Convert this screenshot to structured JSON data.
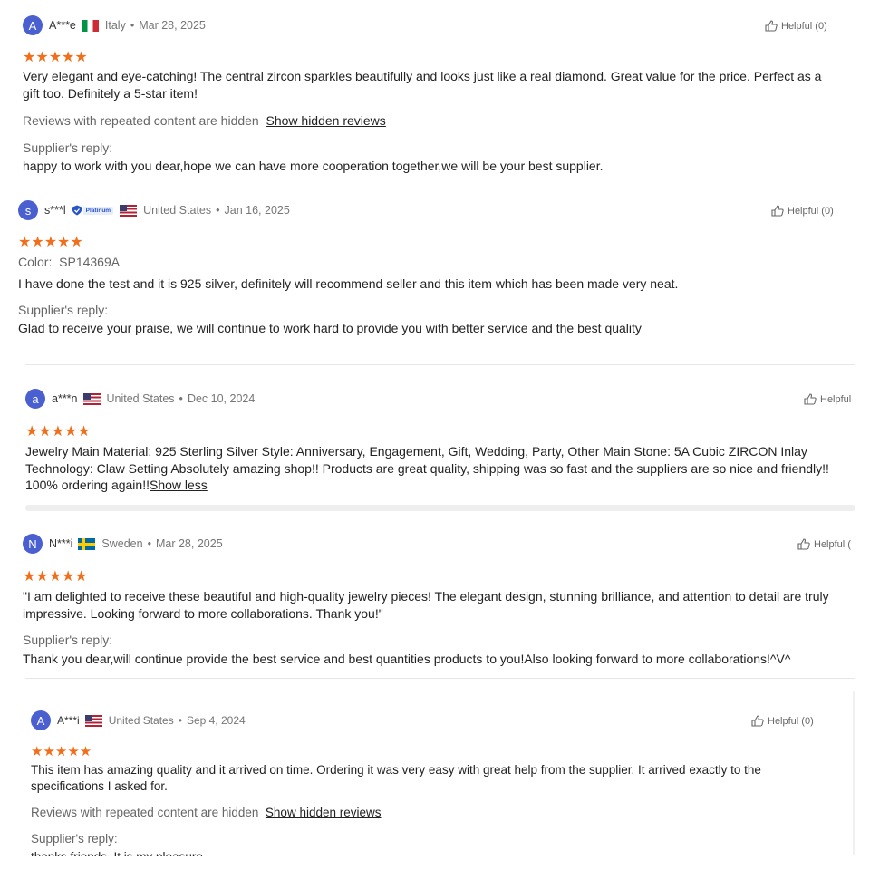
{
  "reviews": [
    {
      "initial": "A",
      "name": "A***e",
      "country": "Italy",
      "date": "Mar 28, 2025",
      "helpful": "Helpful (0)",
      "text": "Very elegant and eye-catching! The central zircon sparkles beautifully and looks just like a real diamond. Great value for the price. Perfect as a gift too. Definitely a 5-star item!",
      "hidden_note": "Reviews with repeated content are hidden",
      "hidden_link": "Show hidden reviews",
      "reply_label": "Supplier's reply:",
      "reply": "happy to work with you dear,hope we can have more cooperation together,we will be your best supplier."
    },
    {
      "initial": "s",
      "name": "s***l",
      "badge": "Platinum",
      "country": "United States",
      "date": "Jan 16, 2025",
      "helpful": "Helpful (0)",
      "color_label": "Color:",
      "color_value": "SP14369A",
      "text": "I have done the test and it is 925 silver, definitely will recommend seller and this item which has been made very neat.",
      "reply_label": "Supplier's reply:",
      "reply": "Glad to receive your praise, we will continue to work hard to provide you with better service and the best quality"
    },
    {
      "initial": "a",
      "name": "a***n",
      "country": "United States",
      "date": "Dec 10, 2024",
      "helpful": "Helpful",
      "text": "Jewelry Main Material: 925 Sterling Silver   Style: Anniversary, Engagement, Gift, Wedding, Party, Other Main Stone: 5A Cubic ZIRCON Inlay Technology: Claw Setting Absolutely amazing shop!! Products are great quality, shipping was so fast and the suppliers are so nice and friendly!! 100% ordering again!!",
      "show_less": "Show less"
    },
    {
      "initial": "N",
      "name": "N***i",
      "country": "Sweden",
      "date": "Mar 28, 2025",
      "helpful": "Helpful (",
      "text": "\"I am delighted to receive these beautiful and high-quality jewelry pieces! The elegant design, stunning brilliance, and attention to detail are truly impressive. Looking forward to more collaborations. Thank you!\"",
      "reply_label": "Supplier's reply:",
      "reply": "Thank you dear,will continue provide the best service and best quantities products to you!Also looking forward to more collaborations!^V^"
    },
    {
      "initial": "A",
      "name": "A***i",
      "country": "United States",
      "date": "Sep 4, 2024",
      "helpful": "Helpful (0)",
      "text": "This item has amazing quality and it arrived on time. Ordering it was very easy with great help from the supplier. It arrived exactly to the specifications I asked for.",
      "hidden_note": "Reviews with repeated content are hidden",
      "hidden_link": "Show hidden reviews",
      "reply_label": "Supplier's reply:",
      "reply": "thanks friends, It is my pleasure"
    }
  ],
  "stars": "★★★★★",
  "separator": "•",
  "colors": {
    "accent_star": "#f16f1b",
    "avatar": "#4a5fd0"
  },
  "icons": {
    "helpful": "thumbs-up-icon",
    "badge": "verified-shield-icon"
  }
}
